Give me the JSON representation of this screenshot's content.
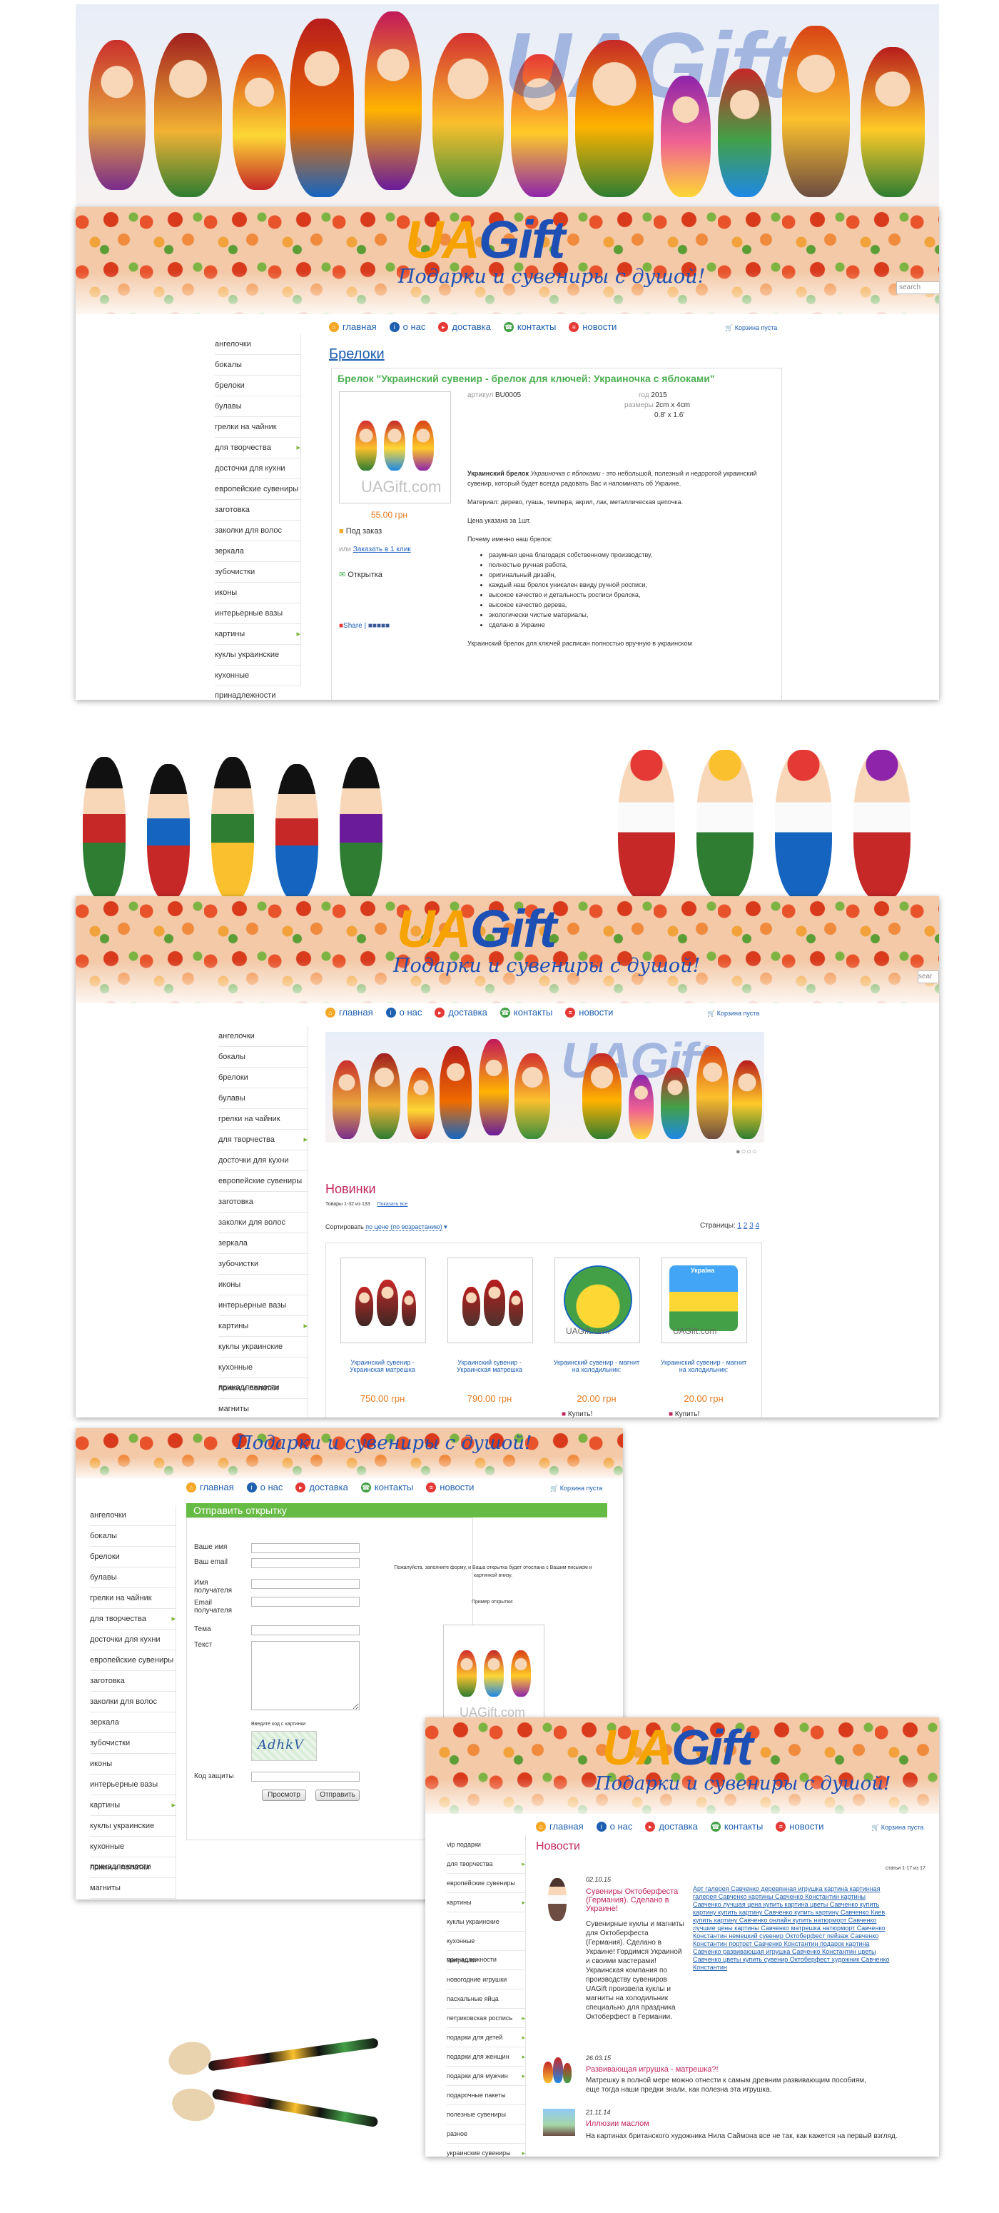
{
  "brand": {
    "ua": "UA",
    "gift": "Gift",
    "tagline": "Подарки и сувениры с душой!",
    "search": "search",
    "search2": "sear"
  },
  "nav": {
    "home": "главная",
    "about": "о нас",
    "delivery": "доставка",
    "contacts": "контакты",
    "news": "новости",
    "cart": "Корзина пуста"
  },
  "colors": {
    "accent_green": "#66bb44",
    "link_blue": "#1e5fb0",
    "price_orange": "#e87a1f",
    "title_pink": "#c0265c",
    "logo_orange": "#f6a300",
    "logo_blue": "#1e4fb5"
  },
  "panel1": {
    "sidebar": [
      "ангелочки",
      "бокалы",
      "брелоки",
      "булавы",
      "грелки на чайник",
      "для творчества",
      "досточки для кухни",
      "европейские сувениры",
      "заготовка",
      "заколки для волос",
      "зеркала",
      "зубочистки",
      "иконы",
      "интерьерные вазы",
      "картины",
      "куклы украинские",
      "кухонные принадлежности"
    ],
    "category": "Брелоки",
    "product_title": "Брелок \"Украинский сувенир - брелок для ключей: Украиночка с яблоками\"",
    "watermark": "UAGift.com",
    "price": "55.00 грн",
    "order_label": "Под заказ",
    "or": "или",
    "one_click": "Заказать в 1 клик",
    "postcard": "Открытка",
    "share": "Share",
    "specs": {
      "article_label": "артикул",
      "article": "BU0005",
      "year_label": "год",
      "year": "2015",
      "size_label": "размеры",
      "size1": "2cm x 4cm",
      "size2": "0.8' x 1.6'"
    },
    "desc_bold": "Украинский брелок",
    "desc_italic": "Украиночка с яблоками",
    "desc_rest": " - это небольшой, полезный и недорогой украинский сувенир, который будет всегда радовать Вас и напоминать об Украине.",
    "material": "Материал: дерево, гуашь, темпера, акрил, лак, металлическая цепочка.",
    "price_note": "Цена указана за 1шт.",
    "why": "Почему именно наш брелок:",
    "bullets": [
      "разумная цена благодаря собственному производству,",
      "полностью ручная работа,",
      "оригинальный дизайн,",
      "каждый наш брелок уникален ввиду ручной росписи,",
      "высокое качество и детальность росписи брелока,",
      "высокое качество дерева,",
      "экологически чистые материалы,",
      "сделано в Украине"
    ],
    "tail": "Украинский брелок для ключей расписан полностью вручную в украинском"
  },
  "panel2": {
    "sidebar": [
      "ангелочки",
      "бокалы",
      "брелоки",
      "булавы",
      "грелки на чайник",
      "для творчества",
      "досточки для кухни",
      "европейские сувениры",
      "заготовка",
      "заколки для волос",
      "зеркала",
      "зубочистки",
      "иконы",
      "интерьерные вазы",
      "картины",
      "куклы украинские",
      "кухонные принадлежности",
      "ложки и лопатки",
      "магниты"
    ],
    "section": "Новинки",
    "shown": "Товары 1-32 из 133",
    "show_all": "Показать все",
    "sort_label": "Сортировать",
    "sort_value": "по цене (по возрастанию)",
    "pages_label": "Страницы:",
    "pages": [
      "1",
      "2",
      "3",
      "4"
    ],
    "products": [
      {
        "name": "Украинский сувенир - Украинская матрешка",
        "price": "750.00 грн"
      },
      {
        "name": "Украинский сувенир - Украинская матрешка",
        "price": "790.00 грн"
      },
      {
        "name": "Украинский сувенир - магнит на холодильник:",
        "price": "20.00 грн",
        "buy": "Купить!"
      },
      {
        "name": "Украинский сувенир - магнит на холодильник:",
        "price": "20.00 грн",
        "buy": "Купить!"
      }
    ],
    "watermark": "UAGift.com",
    "magnet_text": "Україна"
  },
  "panel3": {
    "sidebar": [
      "ангелочки",
      "бокалы",
      "брелоки",
      "булавы",
      "грелки на чайник",
      "для творчества",
      "досточки для кухни",
      "европейские сувениры",
      "заготовка",
      "заколки для волос",
      "зеркала",
      "зубочистки",
      "иконы",
      "интерьерные вазы",
      "картины",
      "куклы украинские",
      "кухонные принадлежности",
      "ложки и лопатки",
      "магниты"
    ],
    "form_title": "Отправить открытку",
    "your_name": "Ваше имя",
    "your_email": "Ваш email",
    "recipient_name": "Имя получателя",
    "recipient_email": "Email получателя",
    "topic": "Тема",
    "text": "Текст",
    "captcha_hint": "Введите код с картинки",
    "captcha": "AdhkV",
    "protect_code": "Код защиты",
    "preview": "Просмотр",
    "send": "Отправить",
    "note": "Пожалуйста, заполните форму, и Ваша открытка будет отослана с Вашим письмом и картинкой внизу.",
    "example": "Пример открытки:",
    "watermark": "UAGift.com"
  },
  "panel4": {
    "sidebar": [
      "vip подарки",
      "для творчества",
      "европейские сувениры",
      "картины",
      "куклы украинские",
      "кухонные принадлежности",
      "матрешки",
      "новогодние игрушки",
      "пасхальные яйца",
      "петриковская роспись",
      "подарки для детей",
      "подарки для женщин",
      "подарки для мужчин",
      "подарочные пакеты",
      "полезные сувениры",
      "разное",
      "украинские сувениры"
    ],
    "section": "Новости",
    "count": "статьи 1-17 из 17",
    "news": [
      {
        "date": "02.10.15",
        "title": "Сувениры Октоберфеста (Германия). Сделано в Украине!",
        "body": "Сувенирные куклы и магниты для Октоберфеста (Германия). Сделано в Украине! Гордимся Украиной и своими мастерами! Украинская компания по производству сувениров UAGift произвела куклы и магниты на холодильник специально для праздника Октоберфест в Германии."
      },
      {
        "date": "26.03.15",
        "title": "Развивающая игрушка - матрешка?!",
        "body": "Матрешку в полной мере можно отнести к самым древним развивающим пособиям, еще тогда наши предки знали, как полезна эта игрушка."
      },
      {
        "date": "21.11.14",
        "title": "Иллюзии маслом",
        "body": "На картинах британского художника Нила Саймона все не так, как кажется на первый взгляд."
      }
    ],
    "tags": "Арт галерея Савченко деревянная игрушка картина картинная галерея Савченко картины Савченко Константин картины Савченко лучшая цена купить картина цветы Савченко купить картину купить картину Савченко купить картину Савченко Киев купить картину Савченко онлайн купить натюрморт Савченко лучшие цены картины Савченко матрешка натюрморт Савченко Константин немецкий сувенир Октоберфест пейзаж Савченко Константин портрет Савченко Константин подарок картина Савченко развивающая игрушка Савченко Константин цветы Савченко цветы купить сувенир Октоберфест художник Савченко Константин"
  }
}
